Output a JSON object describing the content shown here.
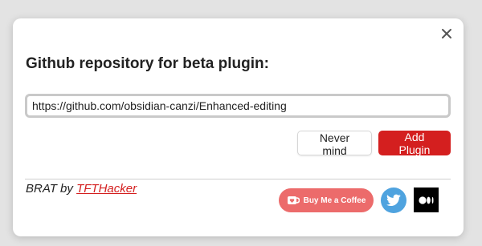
{
  "modal": {
    "title": "Github repository for beta plugin:",
    "close_icon": "close-icon"
  },
  "repo_input": {
    "value": "https://github.com/obsidian-canzi/Enhanced-editing",
    "placeholder": ""
  },
  "buttons": {
    "cancel_label": "Never mind",
    "add_label": "Add Plugin"
  },
  "footer": {
    "credit_prefix": "BRAT by ",
    "author_link": "TFTHacker",
    "coffee_label": "Buy Me a Coffee",
    "coffee_icon": "coffee-cup-icon",
    "twitter_icon": "twitter-bird-icon",
    "medium_icon": "medium-logo-icon"
  },
  "colors": {
    "accent": "#d41f1f",
    "coffee": "#ec6b6b",
    "twitter": "#4fa3df",
    "medium": "#000000"
  }
}
